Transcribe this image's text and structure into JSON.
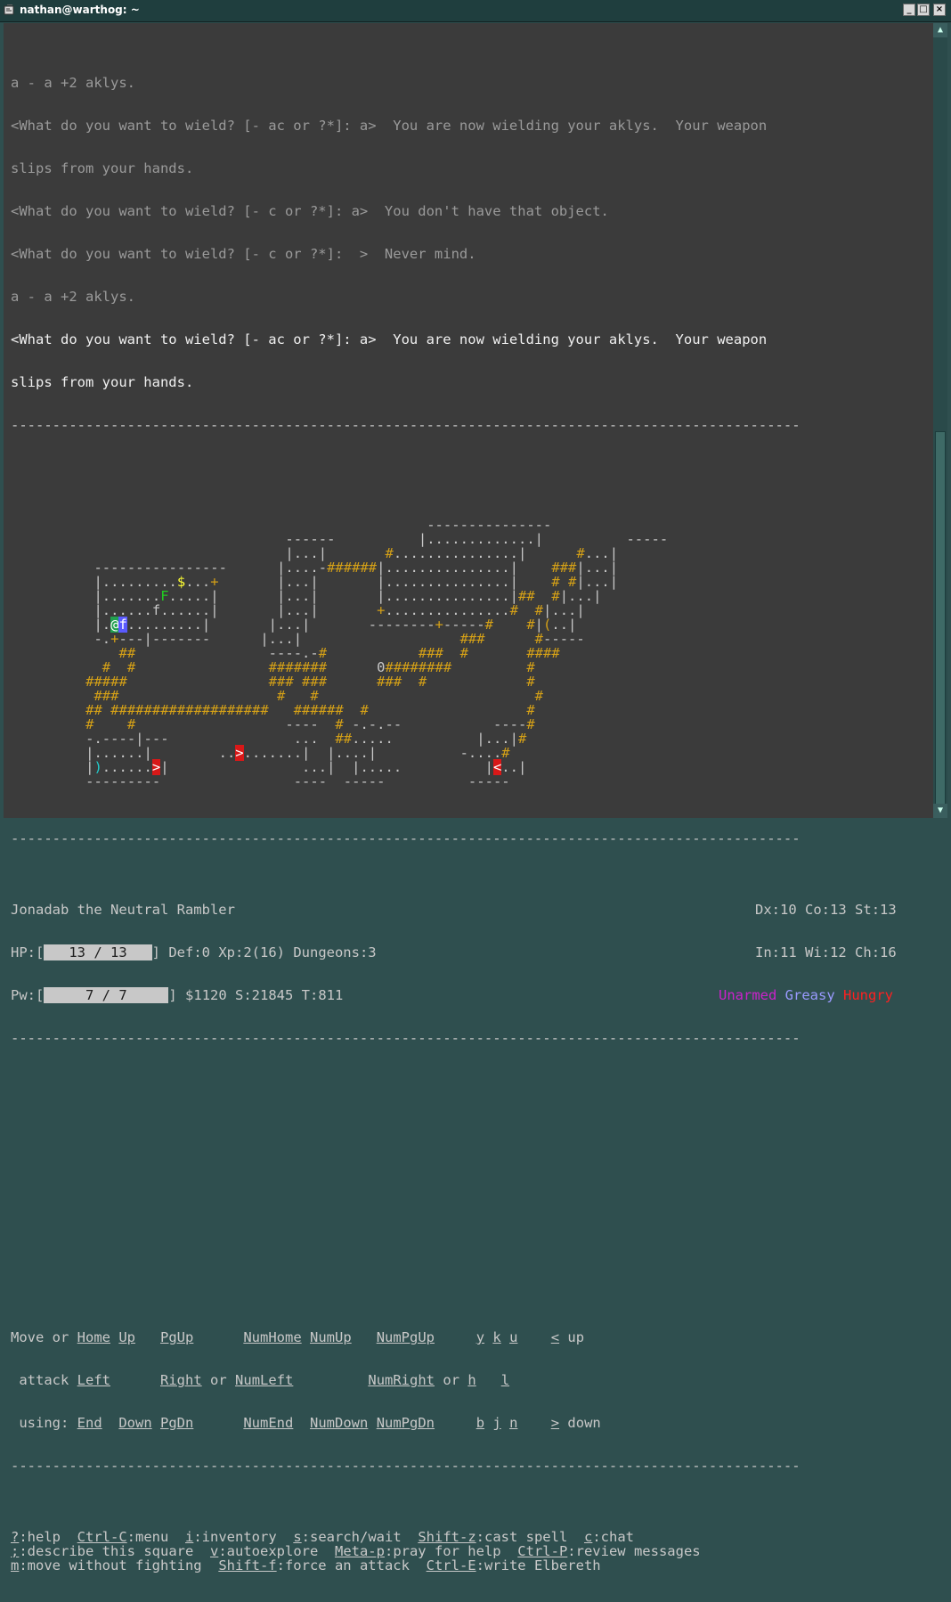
{
  "window": {
    "title": "nathan@warthog: ~"
  },
  "messages": [
    {
      "text": "a - a +2 aklys.",
      "bright": false
    },
    {
      "text": "<What do you want to wield? [- ac or ?*]: a>  You are now wielding your aklys.  Your weapon",
      "bright": false
    },
    {
      "text": "slips from your hands.",
      "bright": false
    },
    {
      "text": "<What do you want to wield? [- c or ?*]: a>  You don't have that object.",
      "bright": false
    },
    {
      "text": "<What do you want to wield? [- c or ?*]:  >  Never mind.",
      "bright": false
    },
    {
      "text": "a - a +2 aklys.",
      "bright": false
    },
    {
      "text": "<What do you want to wield? [- ac or ?*]: a>  You are now wielding your aklys.  Your weapon",
      "bright": true
    },
    {
      "text": "slips from your hands.",
      "bright": true
    }
  ],
  "map_colors": {
    "w": "#c8c8c8",
    "o": "#d4a017",
    "y": "#ffff33",
    "g": "#22cc22",
    "c": "#22cccc",
    "at": "#22a050",
    "f": "#5a5aff",
    "st": "#d81818"
  },
  "map": [
    [],
    [],
    [
      [
        36,
        "w",
        "---------------"
      ]
    ],
    [
      [
        36,
        "w",
        "|............|"
      ]
    ],
    [
      [
        24,
        "w",
        "------"
      ],
      [
        40,
        "w",
        "|..............|"
      ],
      [
        56,
        "w",
        "-----"
      ]
    ],
    [
      [
        3,
        "w",
        "| . . . . . . . . . . "
      ]
    ],
    [],
    [],
    [],
    [],
    [],
    [],
    [],
    [],
    [],
    [],
    [],
    [],
    [],
    []
  ],
  "status": {
    "name": "Jonadab the Neutral Rambler",
    "dx": "Dx:10",
    "co": "Co:13",
    "st": "St:13",
    "in": "In:11",
    "wi": "Wi:12",
    "ch": "Ch:16",
    "hp_label": "HP:[",
    "hp_value": "13 / 13",
    "hp_close": "]",
    "pw_label": "Pw:[",
    "pw_value": "7 / 7",
    "pw_close": "]",
    "def_line": "Def:0 Xp:2(16) Dungeons:3",
    "gold_line": "$1120 S:21845 T:811",
    "cond_unarmed": "Unarmed",
    "cond_greasy": "Greasy",
    "cond_hungry": "Hungry"
  },
  "move_help": {
    "intro": [
      "Move or",
      " attack",
      " using:"
    ],
    "keys": {
      "home": "Home",
      "up": "Up",
      "pgup": "PgUp",
      "left": "Left",
      "right": "Right",
      "or1": "or",
      "end": "End",
      "down": "Down",
      "pgdn": "PgDn",
      "numhome": "NumHome",
      "numup": "NumUp",
      "numpgup": "NumPgUp",
      "numleft": "NumLeft",
      "numright": "NumRight",
      "or2": "or",
      "numend": "NumEnd",
      "numdown": "NumDown",
      "numpgdn": "NumPgDn",
      "y": "y",
      "k": "k",
      "u": "u",
      "h": "h",
      "l": "l",
      "b": "b",
      "j": "j",
      "n": "n",
      "lt": "<",
      "up_word": "up",
      "gt": ">",
      "down_word": "down"
    }
  },
  "commands": [
    [
      {
        "k": "?",
        "d": ":help"
      },
      {
        "k": "Ctrl-C",
        "d": ":menu"
      },
      {
        "k": "i",
        "d": ":inventory"
      },
      {
        "k": "s",
        "d": ":search/wait"
      },
      {
        "k": "Shift-z",
        "d": ":cast spell"
      },
      {
        "k": "c",
        "d": ":chat"
      }
    ],
    [
      {
        "k": ";",
        "d": ":describe this square"
      },
      {
        "k": "v",
        "d": ":autoexplore"
      },
      {
        "k": "Meta-p",
        "d": ":pray for help"
      },
      {
        "k": "Ctrl-P",
        "d": ":review messages"
      }
    ],
    [
      {
        "k": "m",
        "d": ":move without fighting"
      },
      {
        "k": "Shift-f",
        "d": ":force an attack"
      },
      {
        "k": "Ctrl-E",
        "d": ":write Elbereth"
      }
    ]
  ]
}
